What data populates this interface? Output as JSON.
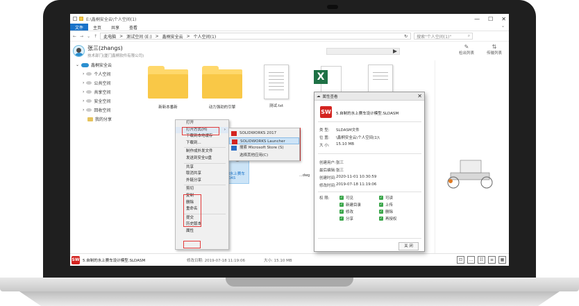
{
  "window": {
    "title": "E:\\鑫桐安全云\\个人空间(1)",
    "controls": [
      "—",
      "☐",
      "✕"
    ]
  },
  "ribbon": {
    "tabs": [
      "文件",
      "主页",
      "共享",
      "查看"
    ],
    "collapse": "⌄"
  },
  "address": {
    "nav_back": "←",
    "nav_fwd": "→",
    "nav_recent": "⌄",
    "nav_up": "↑",
    "crumbs": [
      "此电脑",
      "测试空间 (E:)",
      "鑫桐安全云",
      "个人空间(1)"
    ],
    "sep": ">",
    "refresh": "↻",
    "search_placeholder": "搜索\"个人空间(1)\"",
    "search_icon": "search-icon"
  },
  "user": {
    "name": "张三(zhangs)",
    "dept": "技术部门(厦门鑫桐软件有限公司)",
    "btn_checkout": "检出列表",
    "btn_transfer": "传输列表"
  },
  "tree": {
    "root": "鑫桐安全云",
    "items": [
      "个人空间",
      "公共空间",
      "共享空间",
      "安全空间",
      "回收空间",
      "我的分享"
    ]
  },
  "files": [
    {
      "name": "新新本番新",
      "kind": "folder"
    },
    {
      "name": "动力强劲的引擎",
      "kind": "folder"
    },
    {
      "name": "测试.txt",
      "kind": "doc"
    },
    {
      "name": "",
      "kind": "xls"
    },
    {
      "name": "5.自制的水上\n赛车",
      "kind": "model"
    },
    {
      "name": "测试.dwg",
      "kind": "doc"
    }
  ],
  "file_selected_label": "5.自制的水上赛车",
  "file_selected_ext": "SLDAS",
  "file_dwg_label": "...dwg",
  "context_menu": {
    "items": [
      "打开",
      "打开方式(H)",
      "下载到本地缓存",
      "下载到...",
      "制作成外发文件",
      "发送到安全U盘",
      "共享",
      "取消共享",
      "外链分享",
      "剪切",
      "复制",
      "删除",
      "重命名",
      "提交",
      "历史版本",
      "属性"
    ],
    "arrow": "›"
  },
  "submenu": {
    "items": [
      "SOLIDWORKS 2017",
      "SOLIDWORKS Launcher",
      "搜索 Microsoft Store (S)",
      "选择其他应用(C)"
    ]
  },
  "props": {
    "title": "属性查看",
    "close_x": "✕",
    "filename": "5.自制的水上赛车设计模型.SLDASM",
    "type_label": "类    型:",
    "type_value": "SLDASM文件",
    "loc_label": "位    置:",
    "loc_value": "\\鑫桐安全云\\个人空间(1)\\",
    "size_label": "大    小:",
    "size_value": "15.10 MB",
    "creator_label": "创建用户:",
    "creator_value": "张三",
    "editor_label": "最后编辑:",
    "editor_value": "张三",
    "ctime_label": "创建时间:",
    "ctime_value": "2020-11-01 10:30:59",
    "mtime_label": "修改时间:",
    "mtime_value": "2019-07-18 11:19:06",
    "perm_label": "权    限:",
    "perms": [
      "可见",
      "可读",
      "新建目录",
      "上传",
      "修改",
      "删除",
      "分享",
      "再授权"
    ],
    "close_btn": "关 闭",
    "sw_badge": "SW"
  },
  "status": {
    "badge": "SW",
    "name": "5.自制的水上赛车设计模型.SLDASM",
    "date": "修改日期: 2019-07-18 11:19:06",
    "size": "大小: 15.10 MB"
  },
  "colors": {
    "accent": "#1a73c9",
    "solidworks_red": "#d42420",
    "folder": "#ffd86b",
    "excel_green": "#1e7145",
    "highlight_red": "#e23a3a"
  }
}
